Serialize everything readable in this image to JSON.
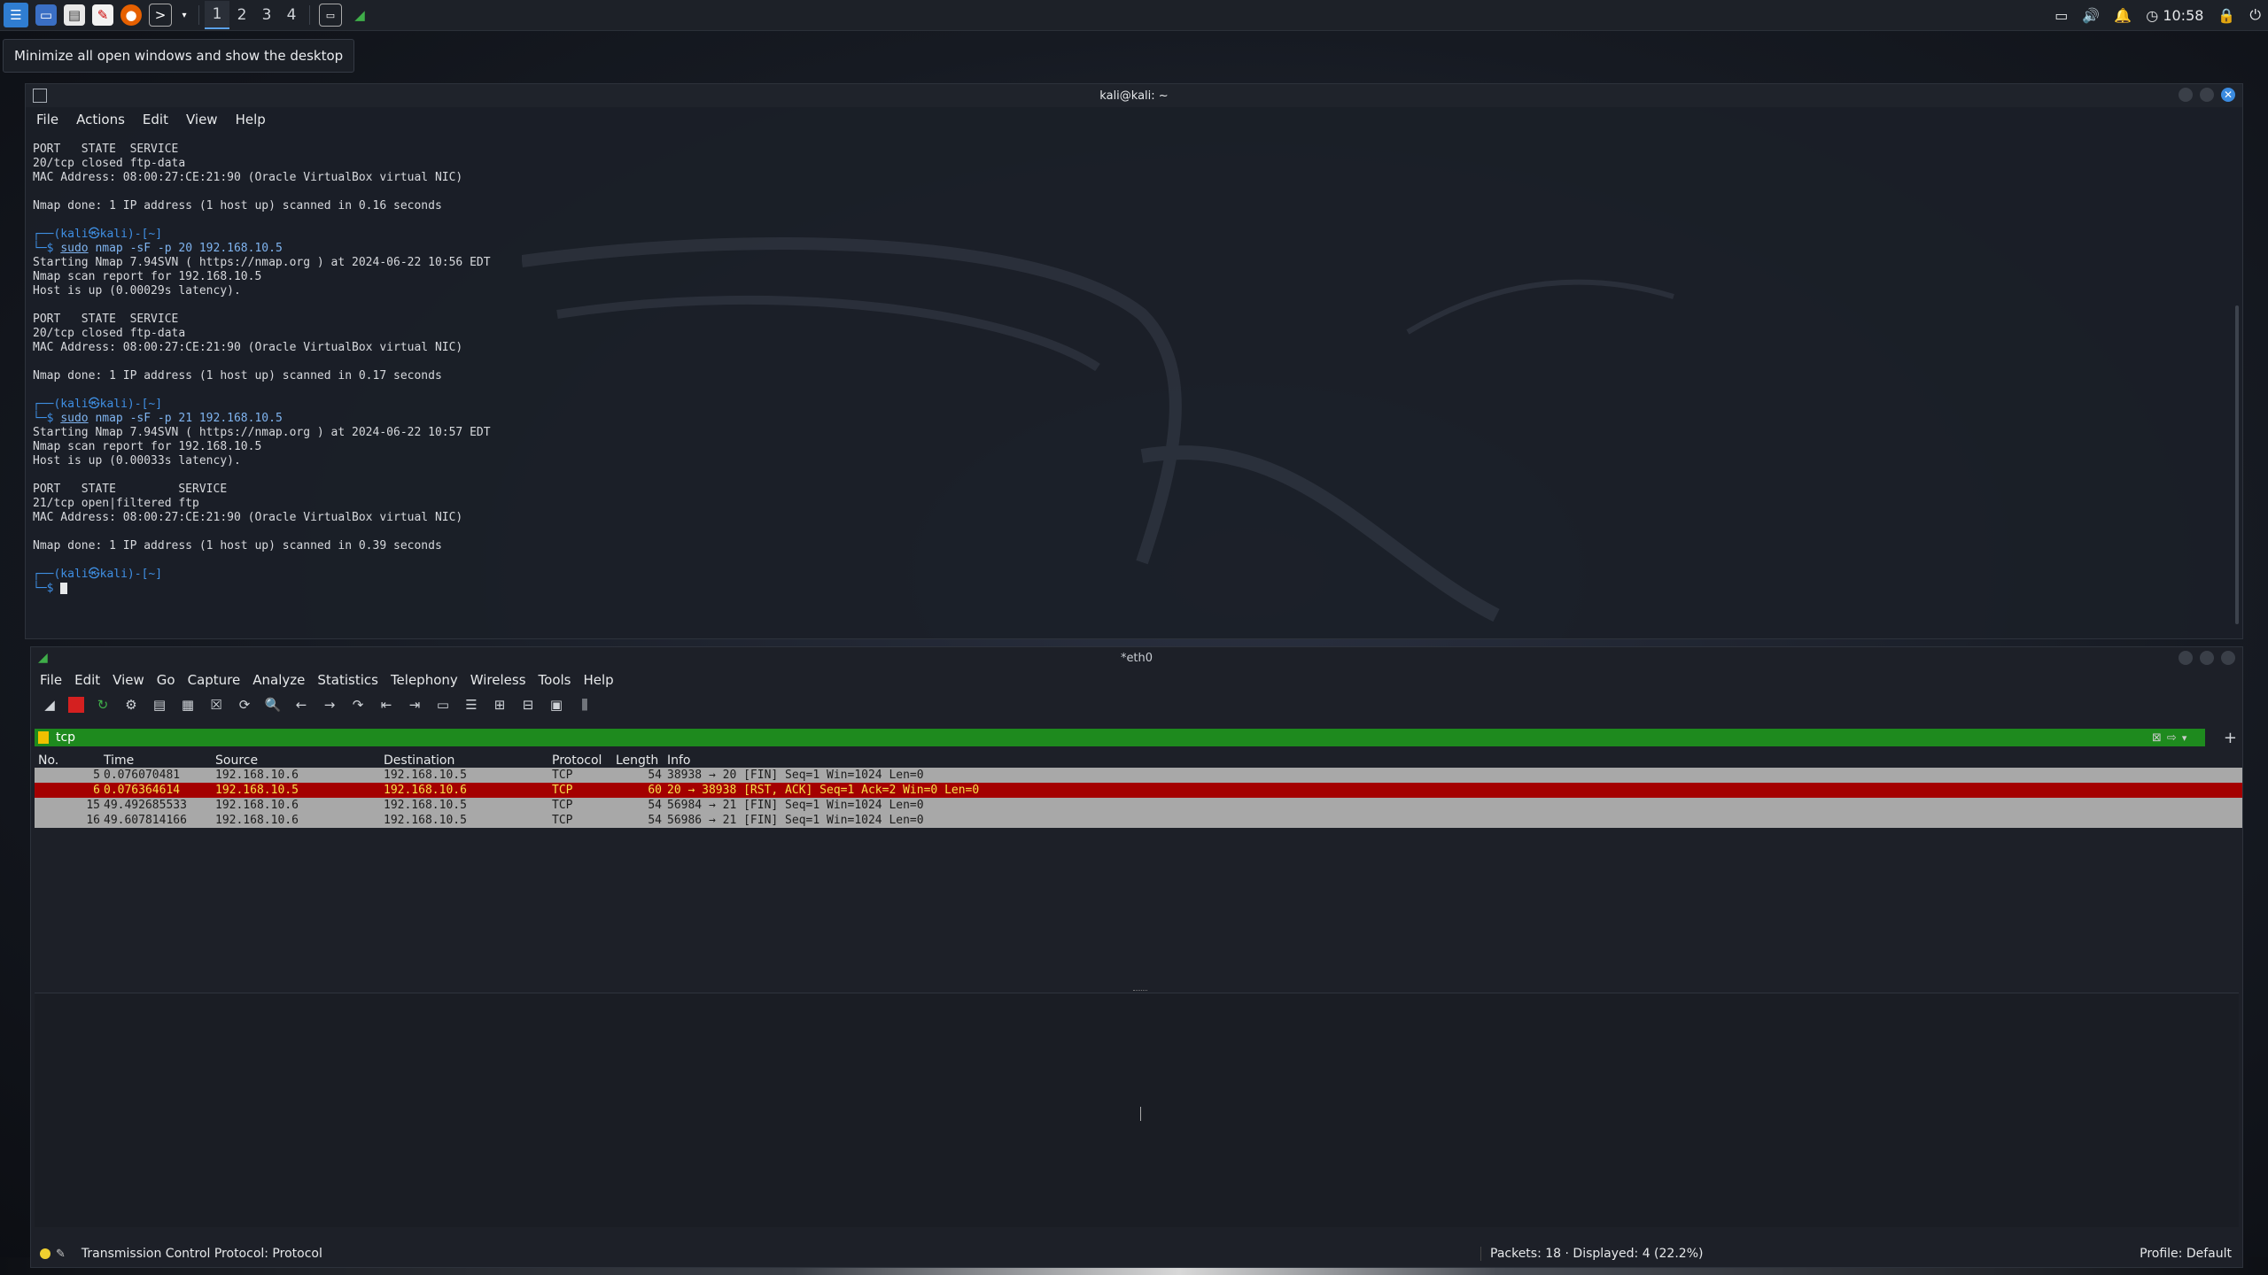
{
  "taskbar": {
    "workspaces": [
      "1",
      "2",
      "3",
      "4"
    ],
    "clock": "10:58",
    "tooltip": "Minimize all open windows and show the desktop"
  },
  "terminal": {
    "title": "kali@kali: ~",
    "menu": [
      "File",
      "Actions",
      "Edit",
      "View",
      "Help"
    ],
    "lines": [
      {
        "t": "PORT   STATE  SERVICE"
      },
      {
        "t": "20/tcp closed ftp-data"
      },
      {
        "t": "MAC Address: 08:00:27:CE:21:90 (Oracle VirtualBox virtual NIC)"
      },
      {
        "t": ""
      },
      {
        "t": "Nmap done: 1 IP address (1 host up) scanned in 0.16 seconds"
      },
      {
        "t": ""
      },
      {
        "prompt": "┌──(kali㉿kali)-[~]"
      },
      {
        "prompt2": "└─$ ",
        "cmd": "sudo",
        "rest": " nmap -sF -p 20 192.168.10.5"
      },
      {
        "t": "Starting Nmap 7.94SVN ( https://nmap.org ) at 2024-06-22 10:56 EDT"
      },
      {
        "t": "Nmap scan report for 192.168.10.5"
      },
      {
        "t": "Host is up (0.00029s latency)."
      },
      {
        "t": ""
      },
      {
        "t": "PORT   STATE  SERVICE"
      },
      {
        "t": "20/tcp closed ftp-data"
      },
      {
        "t": "MAC Address: 08:00:27:CE:21:90 (Oracle VirtualBox virtual NIC)"
      },
      {
        "t": ""
      },
      {
        "t": "Nmap done: 1 IP address (1 host up) scanned in 0.17 seconds"
      },
      {
        "t": ""
      },
      {
        "prompt": "┌──(kali㉿kali)-[~]"
      },
      {
        "prompt2": "└─$ ",
        "cmd": "sudo",
        "rest": " nmap -sF -p 21 192.168.10.5"
      },
      {
        "t": "Starting Nmap 7.94SVN ( https://nmap.org ) at 2024-06-22 10:57 EDT"
      },
      {
        "t": "Nmap scan report for 192.168.10.5"
      },
      {
        "t": "Host is up (0.00033s latency)."
      },
      {
        "t": ""
      },
      {
        "t": "PORT   STATE         SERVICE"
      },
      {
        "t": "21/tcp open|filtered ftp"
      },
      {
        "t": "MAC Address: 08:00:27:CE:21:90 (Oracle VirtualBox virtual NIC)"
      },
      {
        "t": ""
      },
      {
        "t": "Nmap done: 1 IP address (1 host up) scanned in 0.39 seconds"
      },
      {
        "t": ""
      },
      {
        "prompt": "┌──(kali㉿kali)-[~]"
      },
      {
        "prompt2": "└─$ ",
        "cursor": true
      }
    ]
  },
  "wireshark": {
    "title": "*eth0",
    "menu": [
      "File",
      "Edit",
      "View",
      "Go",
      "Capture",
      "Analyze",
      "Statistics",
      "Telephony",
      "Wireless",
      "Tools",
      "Help"
    ],
    "filter": "tcp",
    "columns": [
      "No.",
      "Time",
      "Source",
      "Destination",
      "Protocol",
      "Length",
      "Info"
    ],
    "rows": [
      {
        "no": "5",
        "time": "0.076070481",
        "src": "192.168.10.6",
        "dst": "192.168.10.5",
        "proto": "TCP",
        "len": "54",
        "info": "38938 → 20 [FIN] Seq=1 Win=1024 Len=0",
        "style": "normal"
      },
      {
        "no": "6",
        "time": "0.076364614",
        "src": "192.168.10.5",
        "dst": "192.168.10.6",
        "proto": "TCP",
        "len": "60",
        "info": "20 → 38938 [RST, ACK] Seq=1 Ack=2 Win=0 Len=0",
        "style": "rst"
      },
      {
        "no": "15",
        "time": "49.492685533",
        "src": "192.168.10.6",
        "dst": "192.168.10.5",
        "proto": "TCP",
        "len": "54",
        "info": "56984 → 21 [FIN] Seq=1 Win=1024 Len=0",
        "style": "normal"
      },
      {
        "no": "16",
        "time": "49.607814166",
        "src": "192.168.10.6",
        "dst": "192.168.10.5",
        "proto": "TCP",
        "len": "54",
        "info": "56986 → 21 [FIN] Seq=1 Win=1024 Len=0",
        "style": "normal"
      }
    ],
    "status": {
      "protocol": "Transmission Control Protocol: Protocol",
      "packets": "Packets: 18 · Displayed: 4 (22.2%)",
      "profile": "Profile: Default"
    }
  }
}
